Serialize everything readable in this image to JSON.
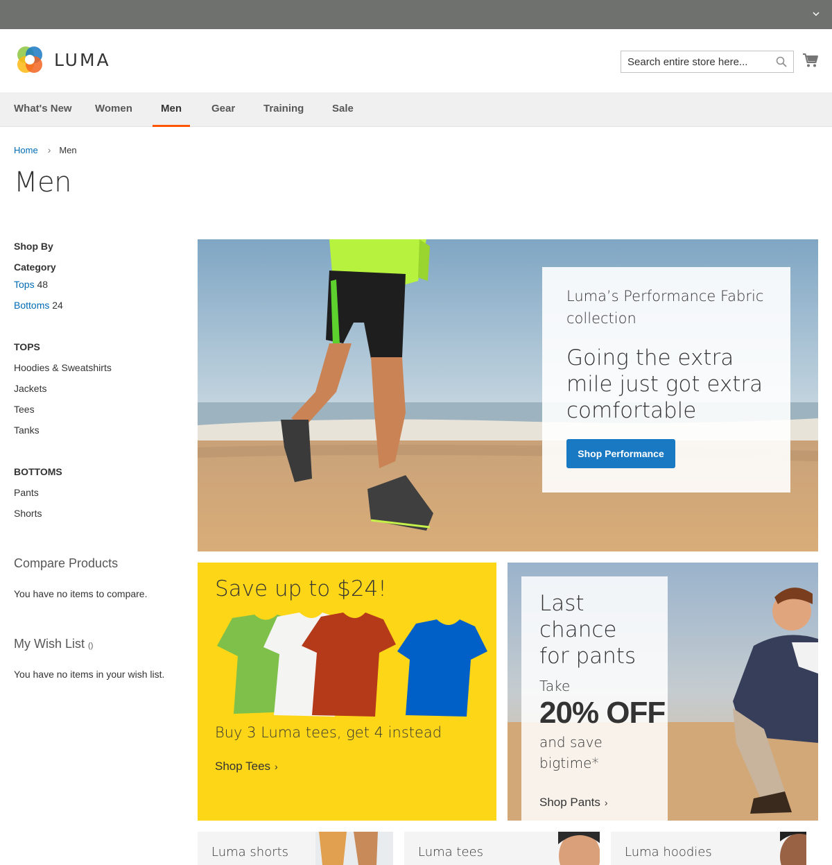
{
  "header": {
    "logo_text": "LUMA",
    "search_placeholder": "Search entire store here...",
    "brand_colors": [
      "#1979c3",
      "#f26522",
      "#8dc63f",
      "#fdb813"
    ]
  },
  "nav": {
    "items": [
      {
        "label": "What's New"
      },
      {
        "label": "Women"
      },
      {
        "label": "Men",
        "active": true
      },
      {
        "label": "Gear"
      },
      {
        "label": "Training"
      },
      {
        "label": "Sale"
      }
    ],
    "active_color": "#ff5501"
  },
  "breadcrumb": {
    "home": "Home",
    "current": "Men"
  },
  "page_title": "Men",
  "sidebar": {
    "shop_by": "Shop By",
    "category_heading": "Category",
    "categories": [
      {
        "label": "Tops",
        "count": "48"
      },
      {
        "label": "Bottoms",
        "count": "24"
      }
    ],
    "tops_heading": "TOPS",
    "tops_links": [
      "Hoodies & Sweatshirts",
      "Jackets",
      "Tees",
      "Tanks"
    ],
    "bottoms_heading": "BOTTOMS",
    "bottoms_links": [
      "Pants",
      "Shorts"
    ],
    "compare_title": "Compare Products",
    "compare_empty": "You have no items to compare.",
    "wishlist_title": "My Wish List",
    "wishlist_count": "()",
    "wishlist_empty": "You have no items in your wish list."
  },
  "hero": {
    "subtitle": "Luma’s Performance Fabric collection",
    "headline": "Going the extra mile just got extra comfortable",
    "button": "Shop Performance",
    "button_color": "#1979c3"
  },
  "tees_promo": {
    "headline": "Save up to $24!",
    "subline": "Buy 3 Luma tees, get 4 instead",
    "link": "Shop Tees",
    "bg_color": "#fdd617"
  },
  "pants_promo": {
    "headline": "Last chance for pants",
    "take": "Take",
    "discount": "20% OFF",
    "save": "and save bigtime*",
    "link": "Shop Pants"
  },
  "bottom_tiles": [
    "Luma shorts",
    "Luma tees",
    "Luma hoodies"
  ]
}
